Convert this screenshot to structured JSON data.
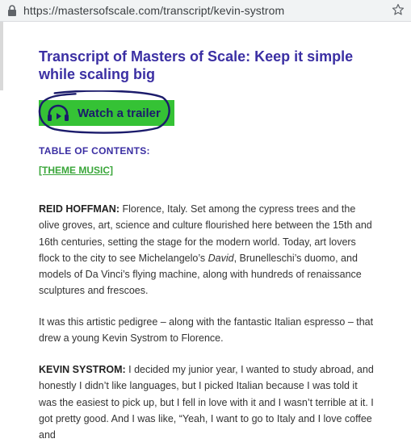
{
  "browser": {
    "url": "https://mastersofscale.com/transcript/kevin-systrom"
  },
  "page": {
    "title": "Transcript of Masters of Scale: Keep it simple while scaling big",
    "trailer_label": "Watch a trailer",
    "toc_heading": "TABLE OF CONTENTS:",
    "toc_links": [
      "[THEME MUSIC]"
    ]
  },
  "transcript": [
    {
      "speaker": "REID HOFFMAN:",
      "text_before": " Florence, Italy. Set among the cypress trees and the olive groves, art, science and culture flourished here between the 15th and 16th centuries, setting the stage for the modern world. Today, art lovers flock to the city to see Michelangelo’s ",
      "italic": "David",
      "text_after": ", Brunelleschi’s duomo, and models of Da Vinci’s flying machine, along with hundreds of renaissance sculptures and frescoes."
    },
    {
      "speaker": "",
      "text_before": "It was this artistic pedigree – along with the fantastic Italian espresso – that drew a young Kevin Systrom to Florence.",
      "italic": "",
      "text_after": ""
    },
    {
      "speaker": "KEVIN SYSTROM:",
      "text_before": " I decided my junior year, I wanted to study abroad, and honestly I didn’t like languages, but I picked Italian because I was told it was the easiest to pick up, but I fell in love with it and I wasn’t terrible at it. I got pretty good. And I was like, “Yeah, I want to go to Italy and I love coffee and",
      "italic": "",
      "text_after": ""
    }
  ],
  "colors": {
    "title": "#3b2fa3",
    "button_bg": "#35c235",
    "circle_ink": "#1b1b6b",
    "toc_link": "#3aa63a"
  },
  "icons": [
    "lock-icon",
    "bookmark-star-icon",
    "headphones-icon"
  ]
}
